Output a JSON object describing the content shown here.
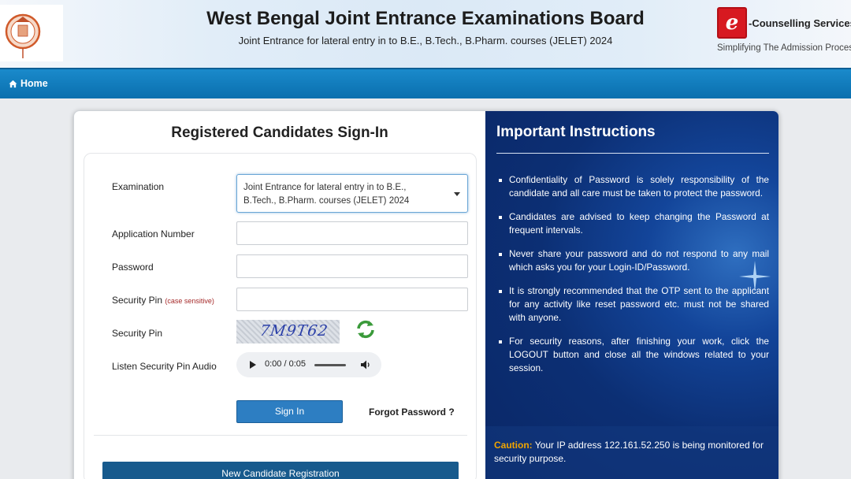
{
  "header": {
    "title": "West Bengal Joint Entrance Examinations Board",
    "subtitle": "Joint Entrance for lateral entry in to B.E., B.Tech., B.Pharm. courses (JELET) 2024",
    "left_logo": "wbjeeb-seal-logo",
    "right_logo": {
      "icon": "e-counselling-logo",
      "badge": "e",
      "text": "-Counselling Services",
      "tagline": "Simplifying The Admission Process"
    }
  },
  "nav": {
    "home_icon": "home-icon",
    "home_label": "Home"
  },
  "signin": {
    "title": "Registered Candidates Sign-In",
    "examination_label": "Examination",
    "examination_value": "Joint Entrance for lateral entry in to B.E., B.Tech., B.Pharm. courses (JELET) 2024",
    "application_number_label": "Application Number",
    "application_number_value": "",
    "password_label": "Password",
    "password_value": "",
    "security_pin_label": "Security Pin",
    "security_pin_hint": "(case sensitive)",
    "security_pin_value": "",
    "captcha_label": "Security Pin",
    "captcha_text": "7M9T62",
    "audio_label": "Listen Security Pin Audio",
    "audio_time": "0:00 / 0:05",
    "signin_button": "Sign In",
    "forgot_password": "Forgot Password ?",
    "new_registration_button": "New Candidate Registration"
  },
  "instructions": {
    "title": "Important Instructions",
    "items": [
      "Confidentiality of Password is solely responsibility of the candidate and all care must be taken to protect the password.",
      "Candidates are advised to keep changing the Password at frequent intervals.",
      "Never share your password and do not respond to any mail which asks you for your Login-ID/Password.",
      "It is strongly recommended that the OTP sent to the applicant for any activity like reset password etc. must not be shared with anyone.",
      "For security reasons, after finishing your work, click the LOGOUT button and close all the windows related to your session."
    ],
    "caution_label": "Caution:",
    "caution_text": " Your IP address 122.161.52.250 is being monitored for security purpose."
  },
  "colors": {
    "nav_bar": "#0f7cc0",
    "signin_button": "#2d7ec2",
    "registration_button": "#175a8d",
    "instructions_panel": "#0c2f74",
    "caution_label": "#f0a500"
  }
}
